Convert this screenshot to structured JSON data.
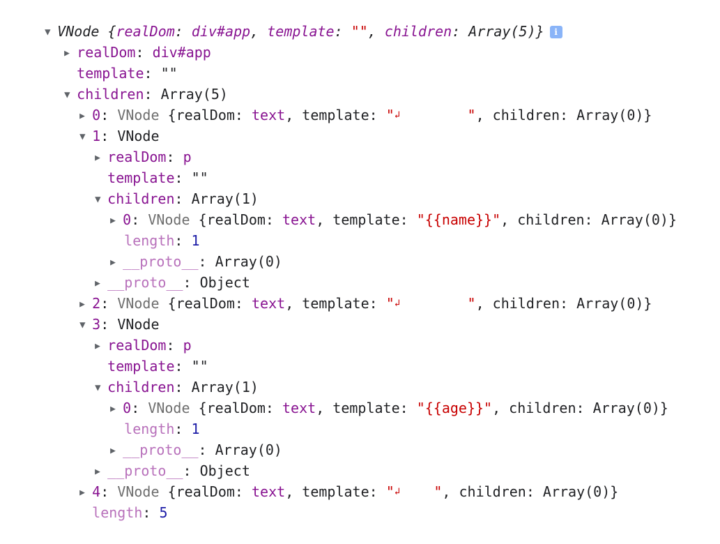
{
  "root": {
    "label": "VNode",
    "summary_open": "{",
    "realDom_key": "realDom",
    "realDom_val": "div#app",
    "template_key": "template",
    "template_val": "\"\"",
    "children_key": "children",
    "children_val": "Array(5)",
    "summary_close": "}"
  },
  "tree": {
    "realDom": {
      "key": "realDom",
      "value": "div#app"
    },
    "template": {
      "key": "template",
      "value": "\"\""
    },
    "children": {
      "key": "children",
      "value": "Array(5)"
    },
    "items": [
      {
        "index": "0",
        "cls": "VNode",
        "summary_key_realDom": "realDom",
        "summary_realDom": "text",
        "summary_key_template": "template",
        "summary_template_open": "\"",
        "return_symbol": "↲",
        "summary_template_pad": "        ",
        "summary_template_close": "\"",
        "summary_key_children": "children",
        "summary_children": "Array(0)"
      },
      {
        "index": "1",
        "cls": "VNode",
        "realDom": {
          "key": "realDom",
          "value": "p"
        },
        "template": {
          "key": "template",
          "value": "\"\""
        },
        "children": {
          "key": "children",
          "value": "Array(1)"
        },
        "child": {
          "index": "0",
          "cls": "VNode",
          "summary_key_realDom": "realDom",
          "summary_realDom": "text",
          "summary_key_template": "template",
          "summary_template": "\"{{name}}\"",
          "summary_key_children": "children",
          "summary_children": "Array(0)"
        },
        "length": {
          "key": "length",
          "value": "1"
        },
        "proto_array": {
          "key": "__proto__",
          "value": "Array(0)"
        },
        "proto_object": {
          "key": "__proto__",
          "value": "Object"
        }
      },
      {
        "index": "2",
        "cls": "VNode",
        "summary_key_realDom": "realDom",
        "summary_realDom": "text",
        "summary_key_template": "template",
        "summary_template_open": "\"",
        "return_symbol": "↲",
        "summary_template_pad": "        ",
        "summary_template_close": "\"",
        "summary_key_children": "children",
        "summary_children": "Array(0)"
      },
      {
        "index": "3",
        "cls": "VNode",
        "realDom": {
          "key": "realDom",
          "value": "p"
        },
        "template": {
          "key": "template",
          "value": "\"\""
        },
        "children": {
          "key": "children",
          "value": "Array(1)"
        },
        "child": {
          "index": "0",
          "cls": "VNode",
          "summary_key_realDom": "realDom",
          "summary_realDom": "text",
          "summary_key_template": "template",
          "summary_template": "\"{{age}}\"",
          "summary_key_children": "children",
          "summary_children": "Array(0)"
        },
        "length": {
          "key": "length",
          "value": "1"
        },
        "proto_array": {
          "key": "__proto__",
          "value": "Array(0)"
        },
        "proto_object": {
          "key": "__proto__",
          "value": "Object"
        }
      },
      {
        "index": "4",
        "cls": "VNode",
        "summary_key_realDom": "realDom",
        "summary_realDom": "text",
        "summary_key_template": "template",
        "summary_template_open": "\"",
        "return_symbol": "↲",
        "summary_template_pad": "    ",
        "summary_template_close": "\"",
        "summary_key_children": "children",
        "summary_children": "Array(0)"
      }
    ],
    "length": {
      "key": "length",
      "value": "5"
    }
  },
  "icons": {
    "expanded": "triangle-down-icon",
    "collapsed": "triangle-right-icon",
    "info": "info-icon"
  },
  "info_badge_text": "i",
  "colors": {
    "key": "#881391",
    "key_faint": "#b871bb",
    "string": "#c80000",
    "number": "#1a1aa6",
    "info_badge": "#8ab4f8"
  }
}
